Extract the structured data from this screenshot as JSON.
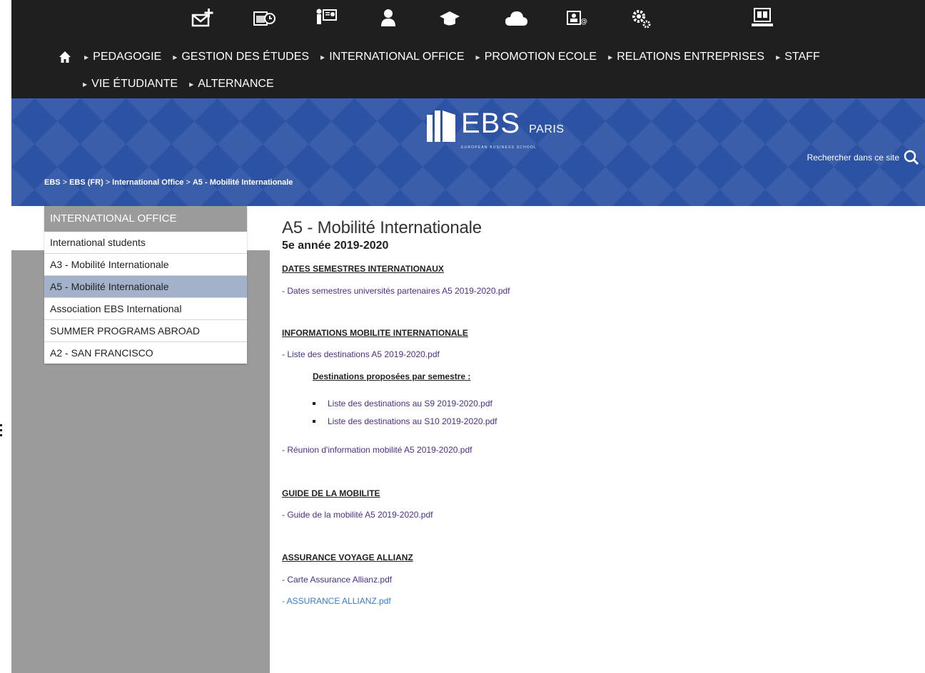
{
  "icon_bar": {
    "icons": [
      "mail-icon",
      "calendar-clock-icon",
      "presentation-icon",
      "person-icon",
      "graduation-cap-icon",
      "cloud-icon",
      "contact-card-icon",
      "settings-gears-icon",
      "laptop-book-icon"
    ]
  },
  "nav": {
    "row1": [
      "PEDAGOGIE",
      "GESTION DES ÉTUDES",
      "INTERNATIONAL OFFICE",
      "PROMOTION ECOLE",
      "RELATIONS ENTREPRISES",
      "STAFF"
    ],
    "row2": [
      "VIE ÉTUDIANTE",
      "ALTERNANCE"
    ]
  },
  "banner": {
    "logo_main": "EBS",
    "logo_paris": "PARIS",
    "logo_sub": "EUROPEAN BUSINESS SCHOOL",
    "search_label": "Rechercher dans ce site",
    "breadcrumb": [
      "EBS",
      "EBS (FR)",
      "International Office",
      "A5 - Mobilité Internationale"
    ]
  },
  "sidebar": {
    "header": "INTERNATIONAL OFFICE",
    "items": [
      "International students",
      "A3 - Mobilité Internationale",
      "A5 - Mobilité Internationale",
      "Association EBS International",
      "SUMMER PROGRAMS ABROAD",
      "A2 - SAN FRANCISCO"
    ],
    "active_index": 2
  },
  "main": {
    "title": "A5 - Mobilité Internationale",
    "subtitle": "5e année 2019-2020",
    "s1_title": "DATES SEMESTRES INTERNATIONAUX",
    "s1_link1": "- Dates semestres universités partenaires A5 2019-2020.pdf",
    "s2_title": "INFORMATIONS MOBILITE INTERNATIONALE",
    "s2_link1": "- Liste des destinations A5 2019-2020.pdf",
    "s2_subhead": "Destinations proposées par semestre :",
    "s2_bullet1": "Liste des destinations au S9 2019-2020.pdf",
    "s2_bullet2": "Liste des destinations au S10 2019-2020.pdf",
    "s2_link2": "- Réunion d'information mobilité A5 2019-2020.pdf",
    "s3_title": "GUIDE DE LA MOBILITE",
    "s3_link1": "- Guide de la mobilité A5 2019-2020.pdf",
    "s4_title": "ASSURANCE VOYAGE ALLIANZ",
    "s4_link1": "- Carte Assurance Allianz.pdf",
    "s4_link2": "- ASSURANCE ALLIANZ.pdf"
  },
  "colors": {
    "topbar": "#1f1f1f",
    "banner": "#2b52a3",
    "sidebar_grey": "#9b9b9b",
    "active_item": "#a3b1cb",
    "link_purple": "#4a2f86",
    "link_blue": "#3a7cc9"
  }
}
